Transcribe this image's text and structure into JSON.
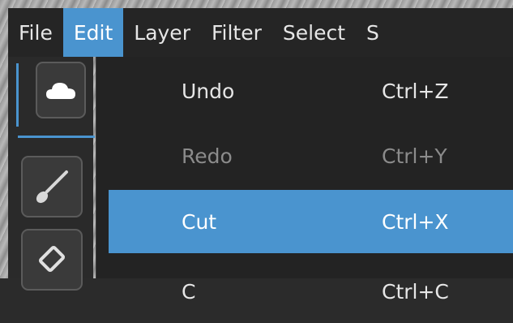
{
  "menubar": {
    "items": [
      {
        "label": "File"
      },
      {
        "label": "Edit"
      },
      {
        "label": "Layer"
      },
      {
        "label": "Filter"
      },
      {
        "label": "Select"
      },
      {
        "label": "S"
      }
    ],
    "active": "Edit"
  },
  "toolbar": {
    "tools": [
      {
        "icon": "cloud-icon",
        "selected": true
      },
      {
        "icon": "brush-icon"
      },
      {
        "icon": "eraser-icon"
      }
    ]
  },
  "edit_menu": {
    "items": [
      {
        "label": "Undo",
        "shortcut": "Ctrl+Z",
        "state": "enabled"
      },
      {
        "label": "Redo",
        "shortcut": "Ctrl+Y",
        "state": "disabled"
      },
      {
        "label": "Cut",
        "shortcut": "Ctrl+X",
        "state": "highlighted"
      },
      {
        "label": "C",
        "shortcut": "Ctrl+C",
        "state": "enabled"
      }
    ]
  },
  "colors": {
    "accent": "#4a94cf",
    "menu_background": "#232323",
    "text": "#e6e6e6",
    "disabled_text": "#8b8b8b"
  }
}
